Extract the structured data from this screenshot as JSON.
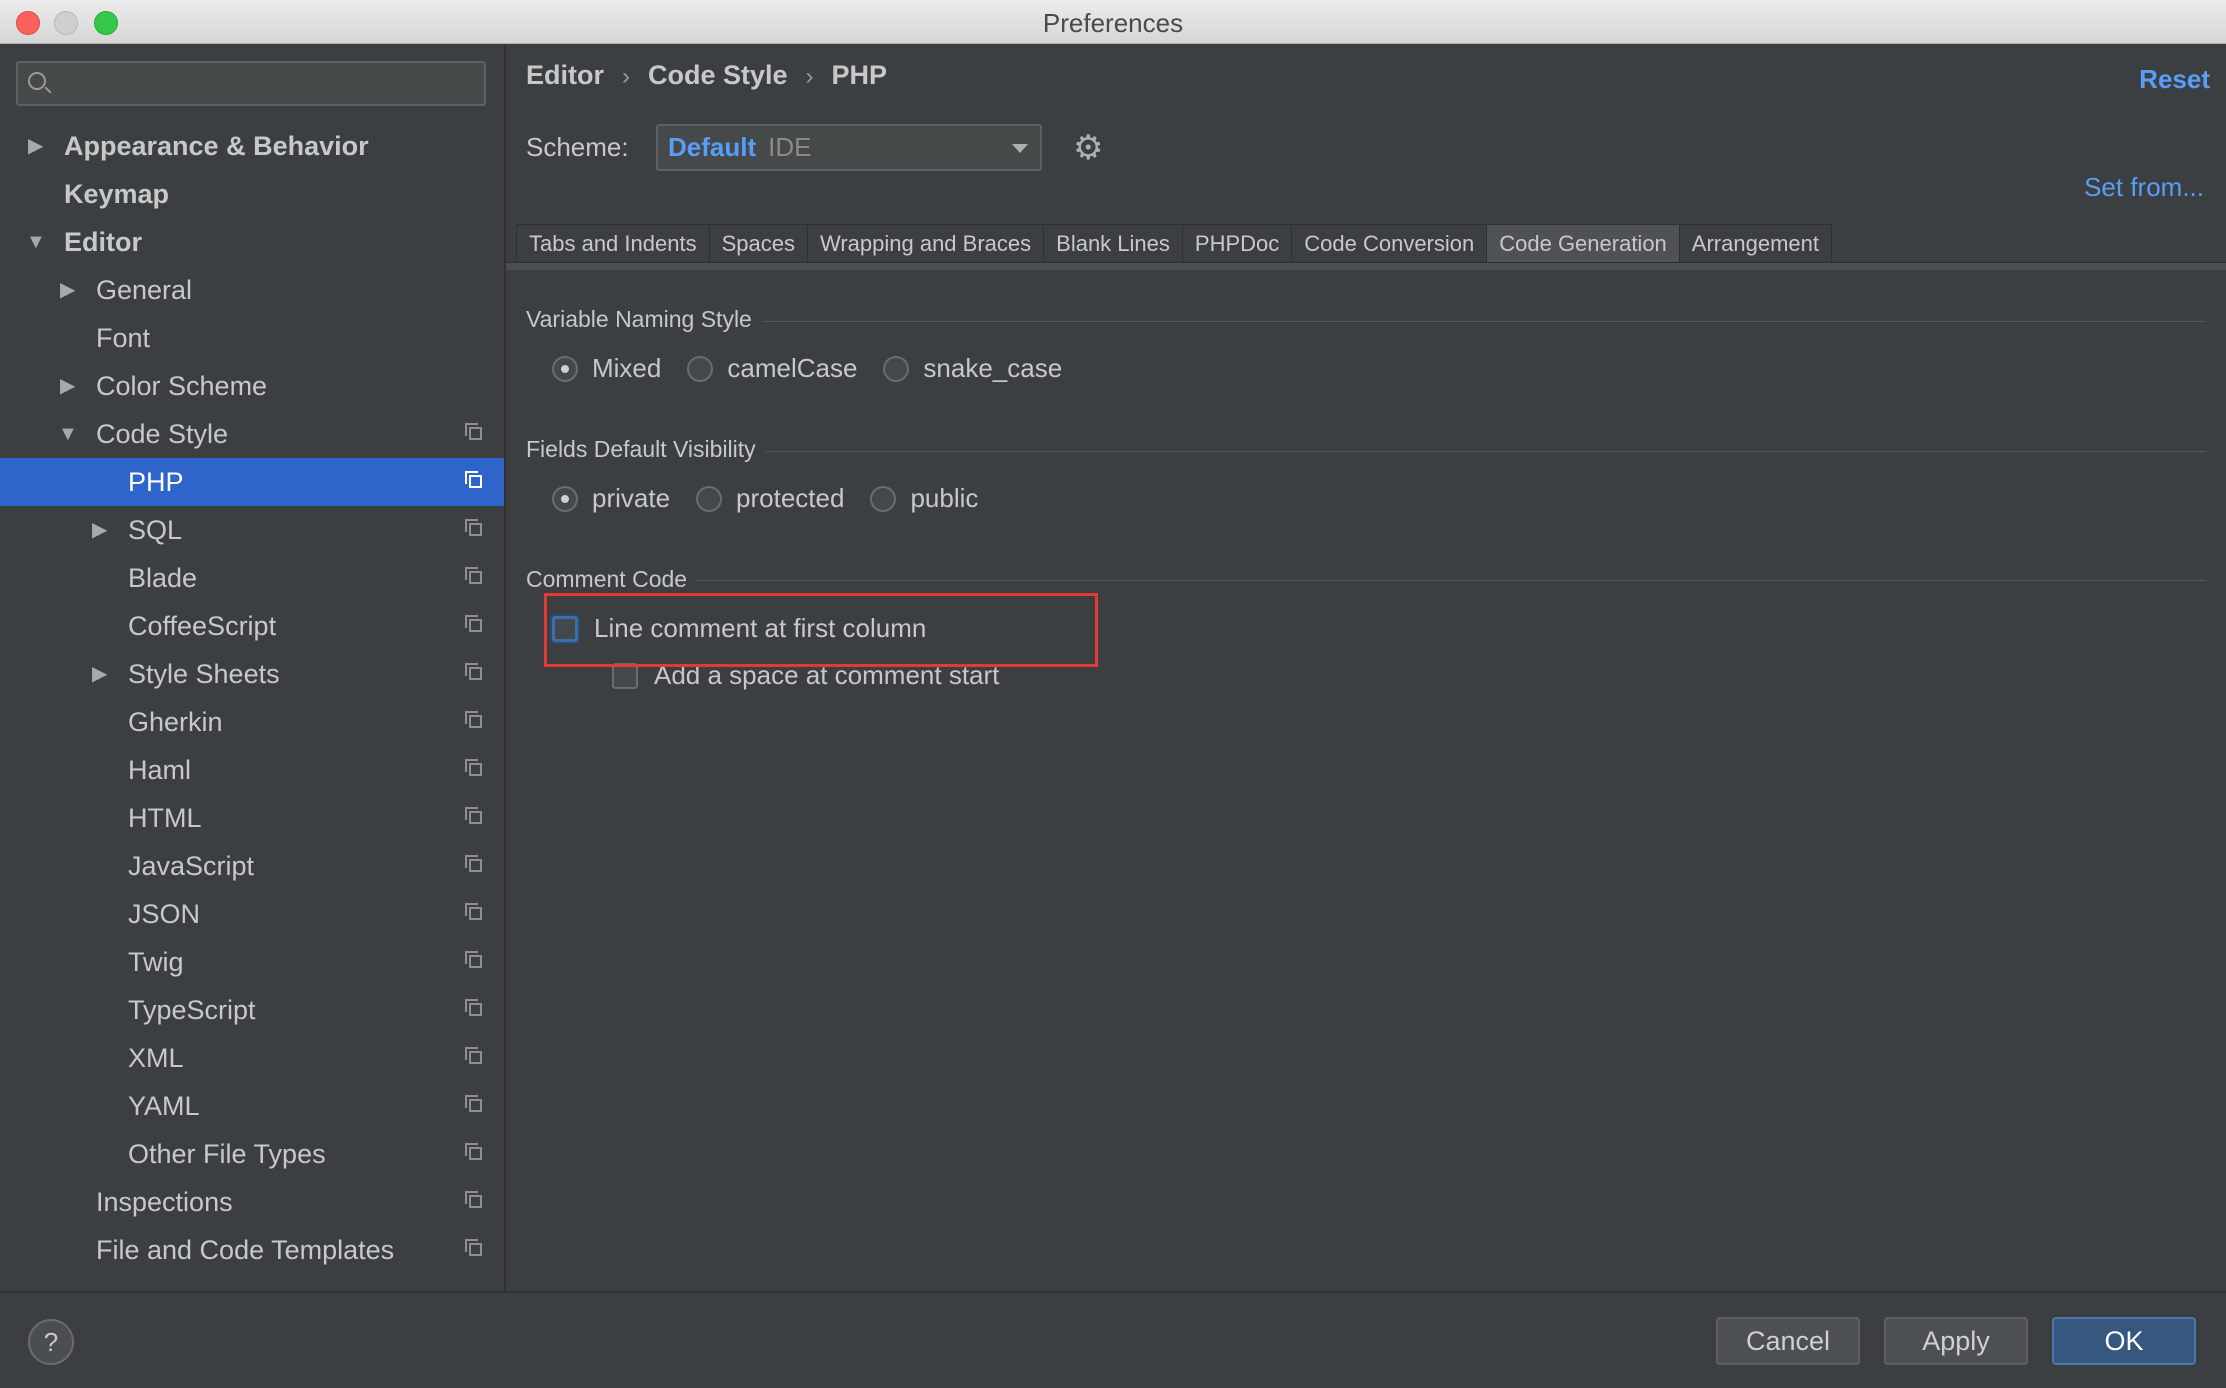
{
  "window": {
    "title": "Preferences"
  },
  "sidebar": {
    "search_placeholder": "",
    "items": [
      {
        "label": "Appearance & Behavior"
      },
      {
        "label": "Keymap"
      },
      {
        "label": "Editor"
      },
      {
        "label": "General"
      },
      {
        "label": "Font"
      },
      {
        "label": "Color Scheme"
      },
      {
        "label": "Code Style"
      },
      {
        "label": "PHP"
      },
      {
        "label": "SQL"
      },
      {
        "label": "Blade"
      },
      {
        "label": "CoffeeScript"
      },
      {
        "label": "Style Sheets"
      },
      {
        "label": "Gherkin"
      },
      {
        "label": "Haml"
      },
      {
        "label": "HTML"
      },
      {
        "label": "JavaScript"
      },
      {
        "label": "JSON"
      },
      {
        "label": "Twig"
      },
      {
        "label": "TypeScript"
      },
      {
        "label": "XML"
      },
      {
        "label": "YAML"
      },
      {
        "label": "Other File Types"
      },
      {
        "label": "Inspections"
      },
      {
        "label": "File and Code Templates"
      }
    ]
  },
  "header": {
    "breadcrumb": [
      "Editor",
      "Code Style",
      "PHP"
    ],
    "reset_label": "Reset",
    "set_from_label": "Set from...",
    "scheme_label": "Scheme:",
    "scheme_value": "Default",
    "scheme_suffix": "IDE"
  },
  "tabs": [
    {
      "label": "Tabs and Indents"
    },
    {
      "label": "Spaces"
    },
    {
      "label": "Wrapping and Braces"
    },
    {
      "label": "Blank Lines"
    },
    {
      "label": "PHPDoc"
    },
    {
      "label": "Code Conversion"
    },
    {
      "label": "Code Generation"
    },
    {
      "label": "Arrangement"
    }
  ],
  "active_tab": "Code Generation",
  "content": {
    "variable_naming": {
      "title": "Variable Naming Style",
      "options": [
        "Mixed",
        "camelCase",
        "snake_case"
      ],
      "selected": "Mixed"
    },
    "fields_visibility": {
      "title": "Fields Default Visibility",
      "options": [
        "private",
        "protected",
        "public"
      ],
      "selected": "private"
    },
    "comment_code": {
      "title": "Comment Code",
      "line_comment_label": "Line comment at first column",
      "add_space_label": "Add a space at comment start"
    }
  },
  "footer": {
    "help_label": "?",
    "cancel_label": "Cancel",
    "apply_label": "Apply",
    "ok_label": "OK"
  },
  "colors": {
    "accent": "#589df6",
    "selection": "#2f65ca",
    "highlight": "#e03a34"
  }
}
